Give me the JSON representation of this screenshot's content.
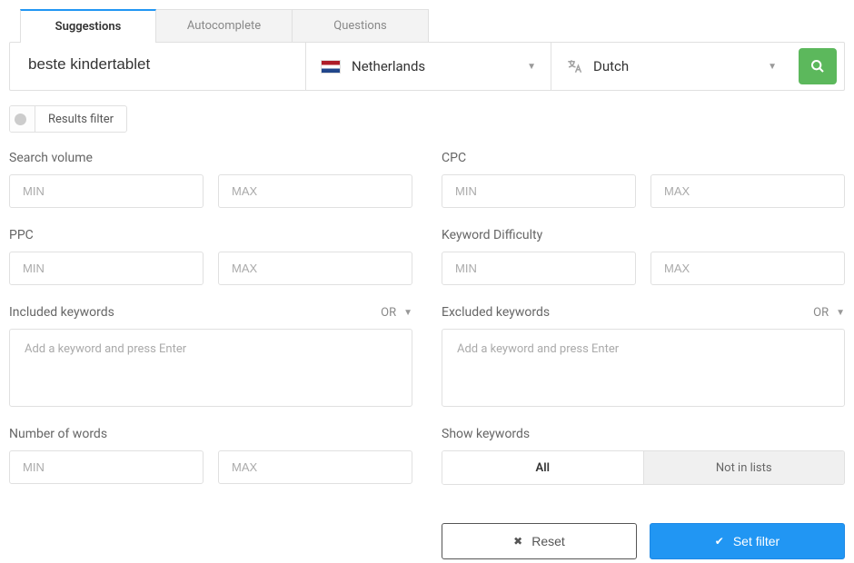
{
  "tabs": {
    "suggestions": "Suggestions",
    "autocomplete": "Autocomplete",
    "questions": "Questions"
  },
  "search": {
    "query": "beste kindertablet",
    "country": "Netherlands",
    "language": "Dutch"
  },
  "filter_toggle": "Results filter",
  "filters": {
    "search_volume": {
      "label": "Search volume",
      "min_ph": "MIN",
      "max_ph": "MAX"
    },
    "cpc": {
      "label": "CPC",
      "min_ph": "MIN",
      "max_ph": "MAX"
    },
    "ppc": {
      "label": "PPC",
      "min_ph": "MIN",
      "max_ph": "MAX"
    },
    "kd": {
      "label": "Keyword Difficulty",
      "min_ph": "MIN",
      "max_ph": "MAX"
    },
    "included": {
      "label": "Included keywords",
      "logic": "OR",
      "placeholder": "Add a keyword and press Enter"
    },
    "excluded": {
      "label": "Excluded keywords",
      "logic": "OR",
      "placeholder": "Add a keyword and press Enter"
    },
    "word_count": {
      "label": "Number of words",
      "min_ph": "MIN",
      "max_ph": "MAX"
    },
    "show": {
      "label": "Show keywords",
      "all": "All",
      "not_in_lists": "Not in lists"
    }
  },
  "actions": {
    "reset": "Reset",
    "set_filter": "Set filter"
  }
}
